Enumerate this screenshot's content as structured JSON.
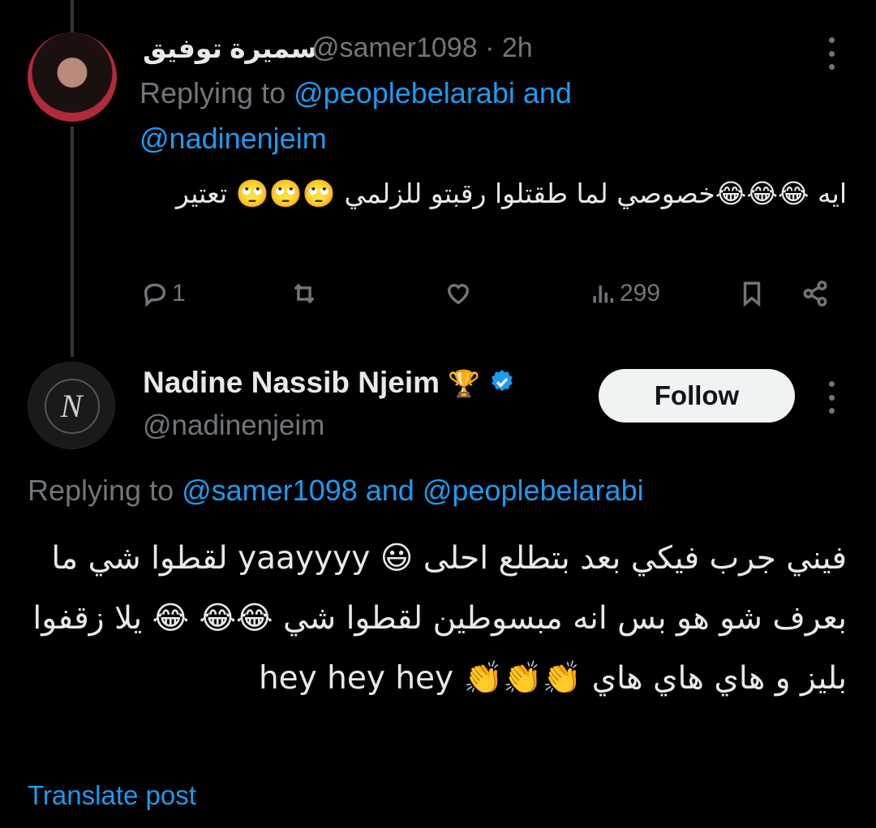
{
  "tweet1": {
    "display_name": "سميرة توفيق",
    "handle": "@samer1098",
    "separator": " · ",
    "time": "2h",
    "replying_prefix": "Replying to ",
    "replying_user1": "@peoplebelarabi",
    "replying_and": " and",
    "replying_user2": "@nadinenjeim",
    "text": "ايه 😂😂😂خصوصي لما طقتلوا رقبتو للزلمي 🙄🙄🙄 تعتير",
    "actions": {
      "replies": "1",
      "reposts": "",
      "likes": "",
      "views": "299"
    }
  },
  "tweet2": {
    "display_name": "Nadine Nassib Njeim",
    "badge_emoji": "🏆",
    "handle": "@nadinenjeim",
    "follow_label": "Follow",
    "replying_prefix": "Replying to ",
    "replying_user1": "@samer1098",
    "replying_and": " and ",
    "replying_user2": "@peoplebelarabi",
    "text": "فيني جرب فيكي بعد بتطلع احلى 😃 yaayyyy لقطوا شي ما بعرف شو هو بس انه مبسوطين لقطوا شي 😂😂 😂 يلا زقفوا بليز و هاي هاي هاي 👏👏👏 hey hey hey",
    "avatar_letter": "N",
    "translate_label": "Translate post"
  },
  "colors": {
    "background": "#000000",
    "text_primary": "#e7e9ea",
    "text_secondary": "#71767b",
    "link": "#1d9bf0",
    "verified": "#1d9bf0"
  },
  "icons": [
    "reply-icon",
    "repost-icon",
    "like-icon",
    "views-icon",
    "bookmark-icon",
    "share-icon",
    "more-icon",
    "verified-icon"
  ]
}
